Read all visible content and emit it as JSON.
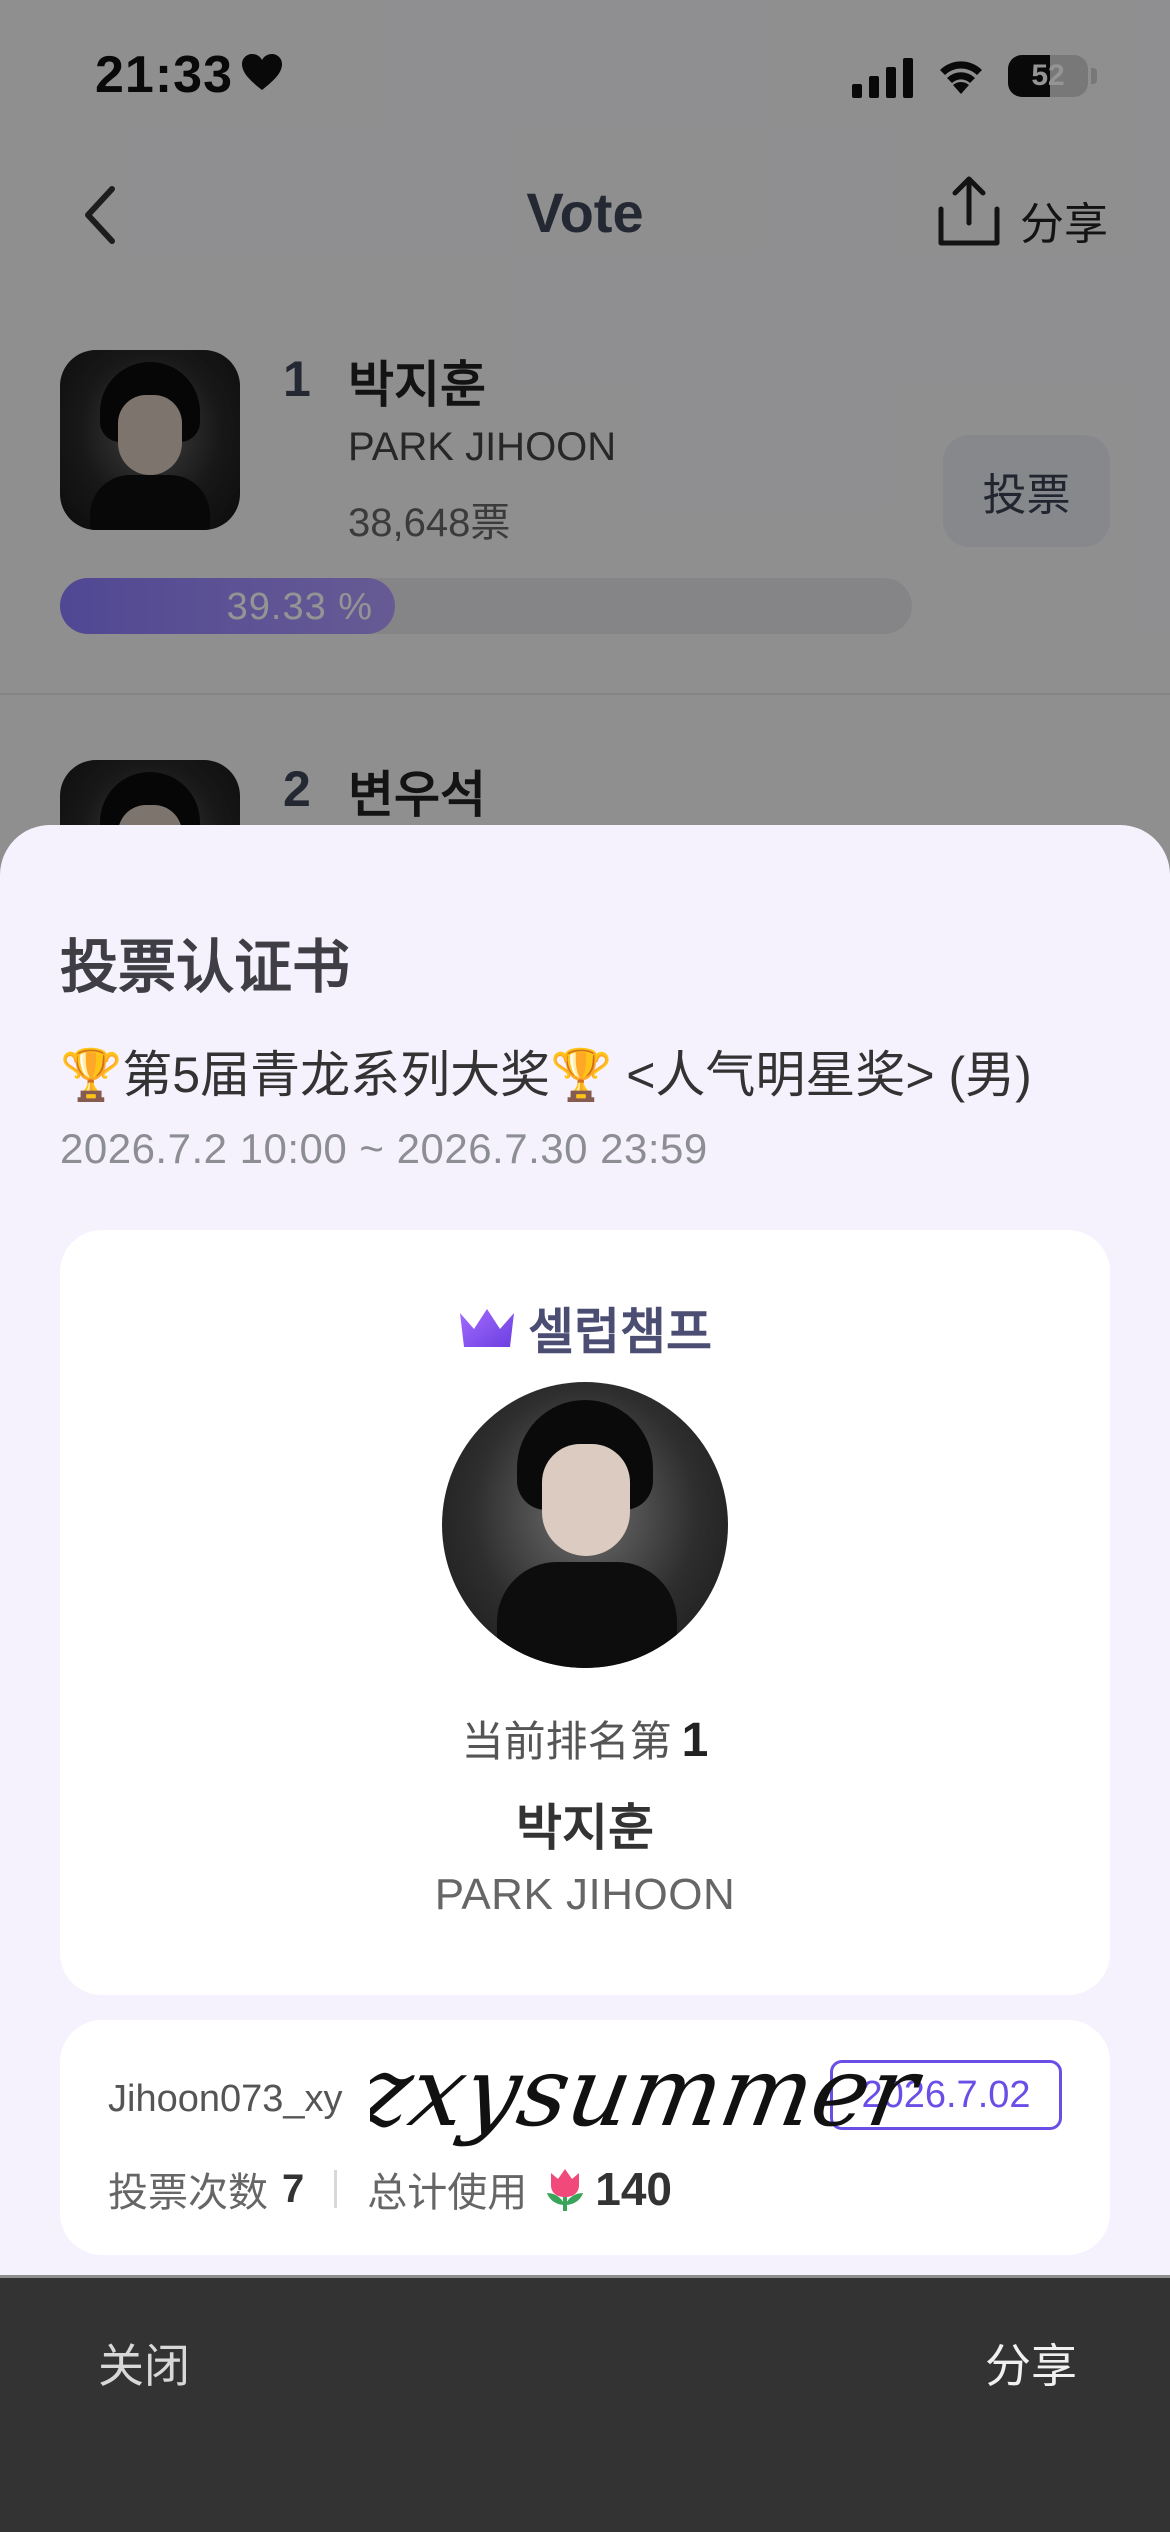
{
  "status": {
    "time": "21:33",
    "battery": "52"
  },
  "nav": {
    "title": "Vote",
    "share_label": "分享"
  },
  "vote_list": [
    {
      "rank": "1",
      "name_kr": "박지훈",
      "name_en": "PARK JIHOON",
      "votes": "38,648票",
      "button": "投票",
      "percent_label": "39.33 %",
      "percent": 39.33
    },
    {
      "rank": "2",
      "name_kr": "변우석"
    }
  ],
  "sheet": {
    "title": "投票认证书",
    "event_title": "🏆第5届青龙系列大奖🏆 <人气明星奖> (男)",
    "event_date": "2026.7.2 10:00 ~ 2026.7.30 23:59",
    "brand": "셀럽챔프",
    "rank_prefix": "当前排名第",
    "rank_value": "1",
    "name_kr": "박지훈",
    "name_en": "PARK JIHOON",
    "username": "Jihoon073_xy",
    "signature": "zxysummer",
    "date_badge": "2026.7.02",
    "vote_count_label": "投票次数",
    "vote_count": "7",
    "total_label": "总计使用",
    "total_value": "140"
  },
  "actions": {
    "close": "关闭",
    "share": "分享"
  },
  "colors": {
    "accent": "#6b4ee6",
    "progress": "#8b7cff",
    "sheet_bg": "#f5f2fe",
    "action_bar": "#333333"
  },
  "icons": [
    "heart-icon",
    "signal-icon",
    "wifi-icon",
    "battery-icon",
    "back-icon",
    "share-icon",
    "crown-icon",
    "tulip-icon"
  ]
}
